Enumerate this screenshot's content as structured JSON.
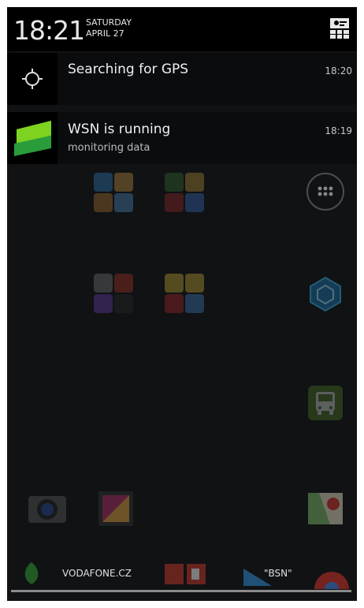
{
  "status_bar": {
    "time": "18:21",
    "day": "SATURDAY",
    "date": "APRIL 27"
  },
  "notifications": [
    {
      "title": "Searching for GPS",
      "subtitle": "",
      "time": "18:20",
      "icon": "gps-crosshair-icon"
    },
    {
      "title": "WSN is running",
      "subtitle": "monitoring data",
      "time": "18:19",
      "icon": "wsn-logo-icon"
    }
  ],
  "dock": {
    "carrier": "VODAFONE.CZ",
    "bsn_label": "\"BSN\""
  },
  "colors": {
    "wsn_green": "#7ed321",
    "wsn_dark_green": "#2a9d3b",
    "shade_bg": "#000000"
  }
}
